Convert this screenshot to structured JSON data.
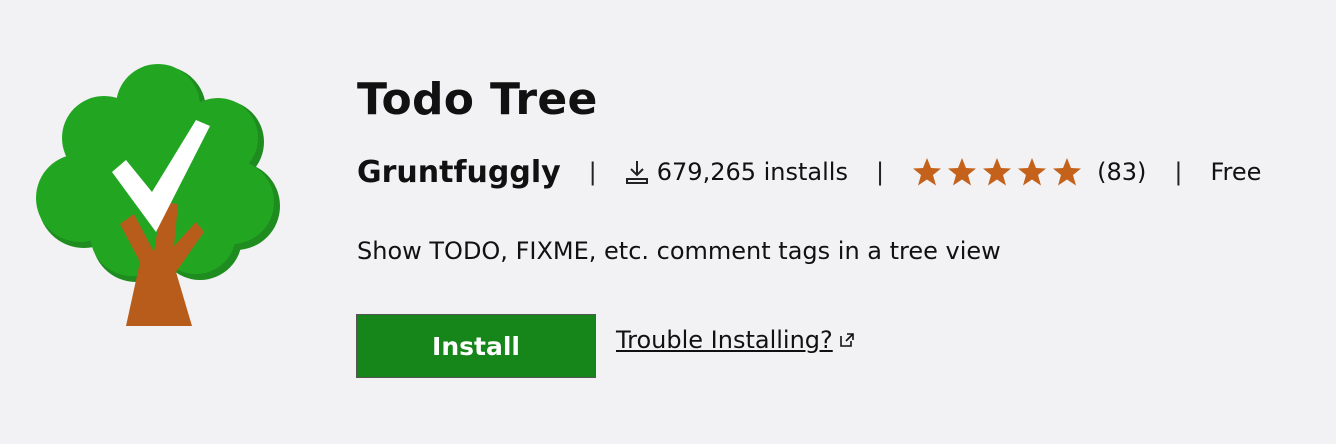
{
  "extension": {
    "name": "Todo Tree",
    "publisher": "Gruntfuggly",
    "installs_text": "679,265 installs",
    "rating_count_text": "(83)",
    "rating_stars": 5,
    "price": "Free",
    "description": "Show TODO, FIXME, etc. comment tags in a tree view"
  },
  "actions": {
    "install_label": "Install",
    "trouble_label": "Trouble Installing?"
  },
  "separator": "|",
  "icons": {
    "logo": "tree-checkmark-logo",
    "download": "download-icon",
    "star": "star-icon",
    "external": "external-link-icon"
  },
  "colors": {
    "background": "#f2f2f4",
    "install_button": "#16861a",
    "star": "#c4621c",
    "tree_green": "#21a121",
    "tree_trunk": "#b85c1c"
  }
}
